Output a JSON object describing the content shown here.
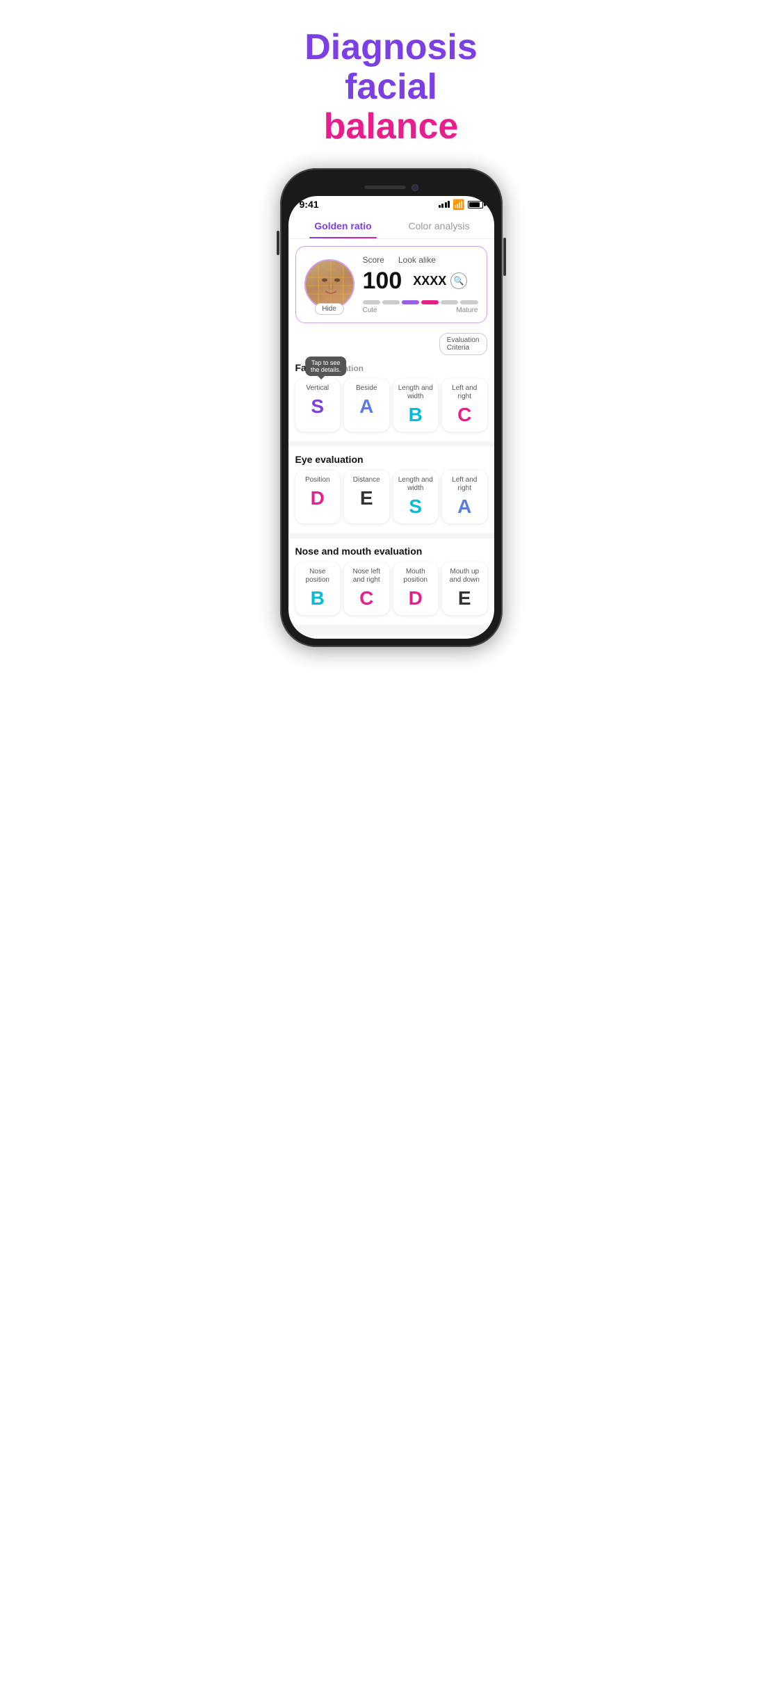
{
  "hero": {
    "title_part1": "Diagnosis facial",
    "title_part2": "balance"
  },
  "status_bar": {
    "time": "9:41",
    "signal_bars": [
      3,
      5,
      7,
      9,
      11
    ],
    "battery_label": "battery"
  },
  "tabs": [
    {
      "id": "golden_ratio",
      "label": "Golden ratio",
      "active": true
    },
    {
      "id": "color_analysis",
      "label": "Color analysis",
      "active": false
    }
  ],
  "score_card": {
    "score_label": "Score",
    "look_alike_label": "Look alike",
    "score_value": "100",
    "look_alike_value": "XXXX",
    "hide_button": "Hide",
    "gauge_left_label": "Cute",
    "gauge_right_label": "Mature",
    "gauge_segments": [
      {
        "color": "#ccc",
        "active": false
      },
      {
        "color": "#ccc",
        "active": false
      },
      {
        "color": "#7B3FE4",
        "active": true
      },
      {
        "color": "#E91E8C",
        "active": true
      },
      {
        "color": "#ccc",
        "active": false
      },
      {
        "color": "#ccc",
        "active": false
      }
    ]
  },
  "eval_criteria_btn": "Evaluation\nCriteria",
  "tooltip": {
    "text": "Tap to see\nthe details."
  },
  "face_evaluation": {
    "section_title": "Face eva",
    "cards": [
      {
        "label": "Vertical",
        "grade": "S",
        "color_class": "color-purple"
      },
      {
        "label": "Beside",
        "grade": "A",
        "color_class": "color-blue-purple"
      },
      {
        "label": "Length and\nwidth",
        "grade": "B",
        "color_class": "color-cyan"
      },
      {
        "label": "Left and\nright",
        "grade": "C",
        "color_class": "color-pink"
      }
    ]
  },
  "eye_evaluation": {
    "section_title": "Eye evaluation",
    "cards": [
      {
        "label": "Position",
        "grade": "D",
        "color_class": "color-pink"
      },
      {
        "label": "Distance",
        "grade": "E",
        "color_class": "color-dark"
      },
      {
        "label": "Length and\nwidth",
        "grade": "S",
        "color_class": "color-cyan"
      },
      {
        "label": "Left and\nright",
        "grade": "A",
        "color_class": "color-blue-purple"
      }
    ]
  },
  "nose_mouth_evaluation": {
    "section_title": "Nose and mouth evaluation",
    "cards": [
      {
        "label": "Nose\nposition",
        "grade": "B",
        "color_class": "color-cyan"
      },
      {
        "label": "Nose left\nand right",
        "grade": "C",
        "color_class": "color-pink"
      },
      {
        "label": "Mouth\nposition",
        "grade": "D",
        "color_class": "color-pink"
      },
      {
        "label": "Mouth up\nand down",
        "grade": "E",
        "color_class": "color-dark"
      }
    ]
  }
}
